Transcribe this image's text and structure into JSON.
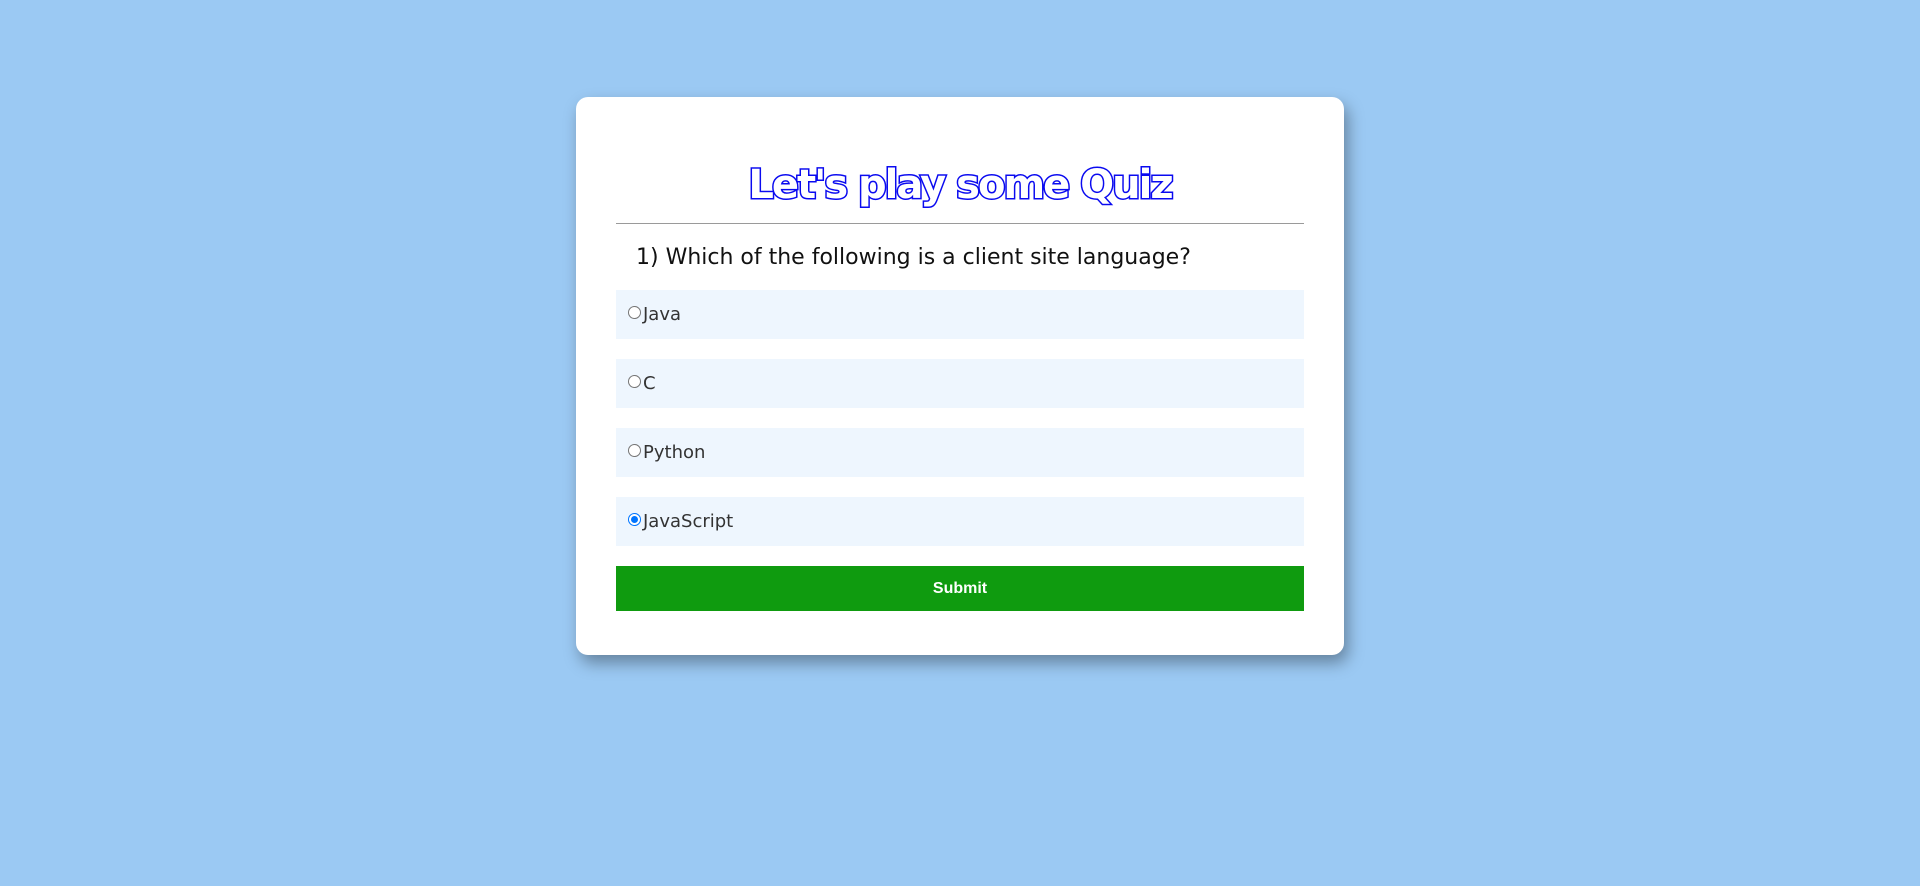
{
  "quiz": {
    "title": "Let's play some Quiz",
    "question": "1) Which of the following is a client site language?",
    "options": [
      {
        "label": "Java",
        "selected": false
      },
      {
        "label": "C",
        "selected": false
      },
      {
        "label": "Python",
        "selected": false
      },
      {
        "label": "JavaScript",
        "selected": true
      }
    ],
    "submit_label": "Submit"
  },
  "colors": {
    "background": "#9bc9f3",
    "title_outline": "#0a0af0",
    "option_background": "#eef6fe",
    "submit_background": "#0f9b0f",
    "radio_accent": "#0075ff"
  }
}
